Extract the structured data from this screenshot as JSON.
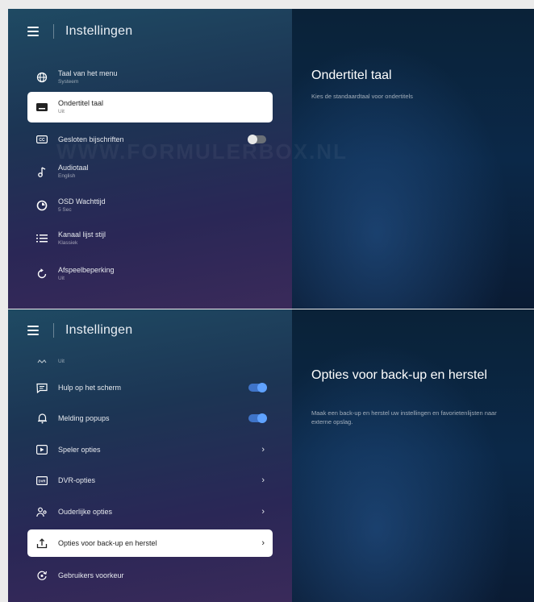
{
  "top": {
    "header_title": "Instellingen",
    "items": [
      {
        "label": "Taal van het menu",
        "sub": "Systeem",
        "icon": "globe-icon"
      },
      {
        "label": "Ondertitel taal",
        "sub": "Uit",
        "icon": "subtitles-icon",
        "selected": true
      },
      {
        "label": "Gesloten bijschriften",
        "sub": "",
        "icon": "closed-captions-icon",
        "toggle": "off"
      },
      {
        "label": "Audiotaal",
        "sub": "English",
        "icon": "music-note-icon"
      },
      {
        "label": "OSD Wachttijd",
        "sub": "5 Sec",
        "icon": "timer-icon"
      },
      {
        "label": "Kanaal lijst stijl",
        "sub": "Klassiek",
        "icon": "list-icon"
      },
      {
        "label": "Afspeelbeperking",
        "sub": "Uit",
        "icon": "refresh-icon"
      }
    ],
    "detail_title": "Ondertitel taal",
    "detail_desc": "Kies de standaardtaal voor ondertitels"
  },
  "bottom": {
    "header_title": "Instellingen",
    "partial_item_sub": "Uit",
    "items": [
      {
        "label": "Hulp op het scherm",
        "icon": "help-chat-icon",
        "toggle": "on"
      },
      {
        "label": "Melding popups",
        "icon": "bell-icon",
        "toggle": "on"
      },
      {
        "label": "Speler opties",
        "icon": "player-icon",
        "chevron": "›"
      },
      {
        "label": "DVR-opties",
        "icon": "dvr-icon",
        "chevron": "›"
      },
      {
        "label": "Ouderlijke opties",
        "icon": "parental-icon",
        "chevron": "›"
      },
      {
        "label": "Opties voor back-up en herstel",
        "icon": "backup-icon",
        "chevron": "›",
        "selected": true
      },
      {
        "label": "Gebruikers voorkeur",
        "icon": "user-preferences-icon"
      }
    ],
    "detail_title": "Opties voor back-up en herstel",
    "detail_desc": "Maak een back-up en herstel uw instellingen en favorietenlijsten naar externe opslag."
  },
  "watermark": "WWW.FORMULERBOX.NL"
}
